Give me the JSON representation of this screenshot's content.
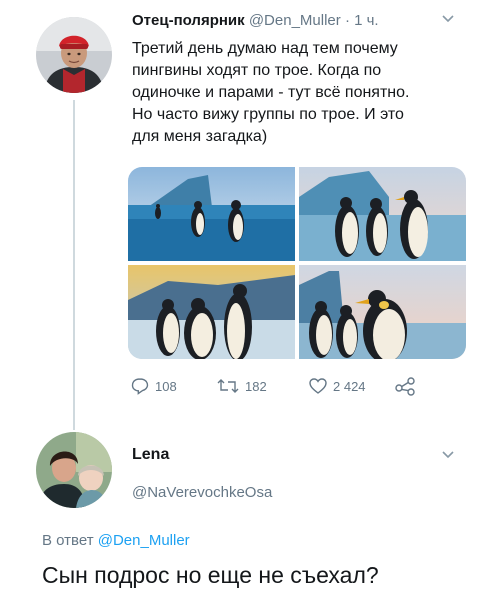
{
  "tweet": {
    "author_name": "Отец-полярник",
    "author_handle": "@Den_Muller",
    "separator": "·",
    "time": "1 ч.",
    "text_lines": [
      "Третий день думаю над тем почему",
      "пингвины ходят по трое. Когда по",
      "одиночке и парами - тут всё понятно.",
      "Но часто вижу группы по трое. И это",
      "для меня загадка)"
    ],
    "replies": "108",
    "retweets": "182",
    "likes": "2 424"
  },
  "reply": {
    "author_name": "Lena",
    "author_handle": "@NaVerevochkeOsa",
    "reply_prefix": "В ответ",
    "reply_to": "@Den_Muller",
    "text": "Сын подрос но еще не съехал?"
  },
  "colors": {
    "accent": "#1da1f2",
    "secondary_text": "#657786",
    "thread_line": "#cfd9de"
  },
  "icons": [
    "chevron-down-icon",
    "reply-icon",
    "retweet-icon",
    "like-icon",
    "share-icon"
  ]
}
